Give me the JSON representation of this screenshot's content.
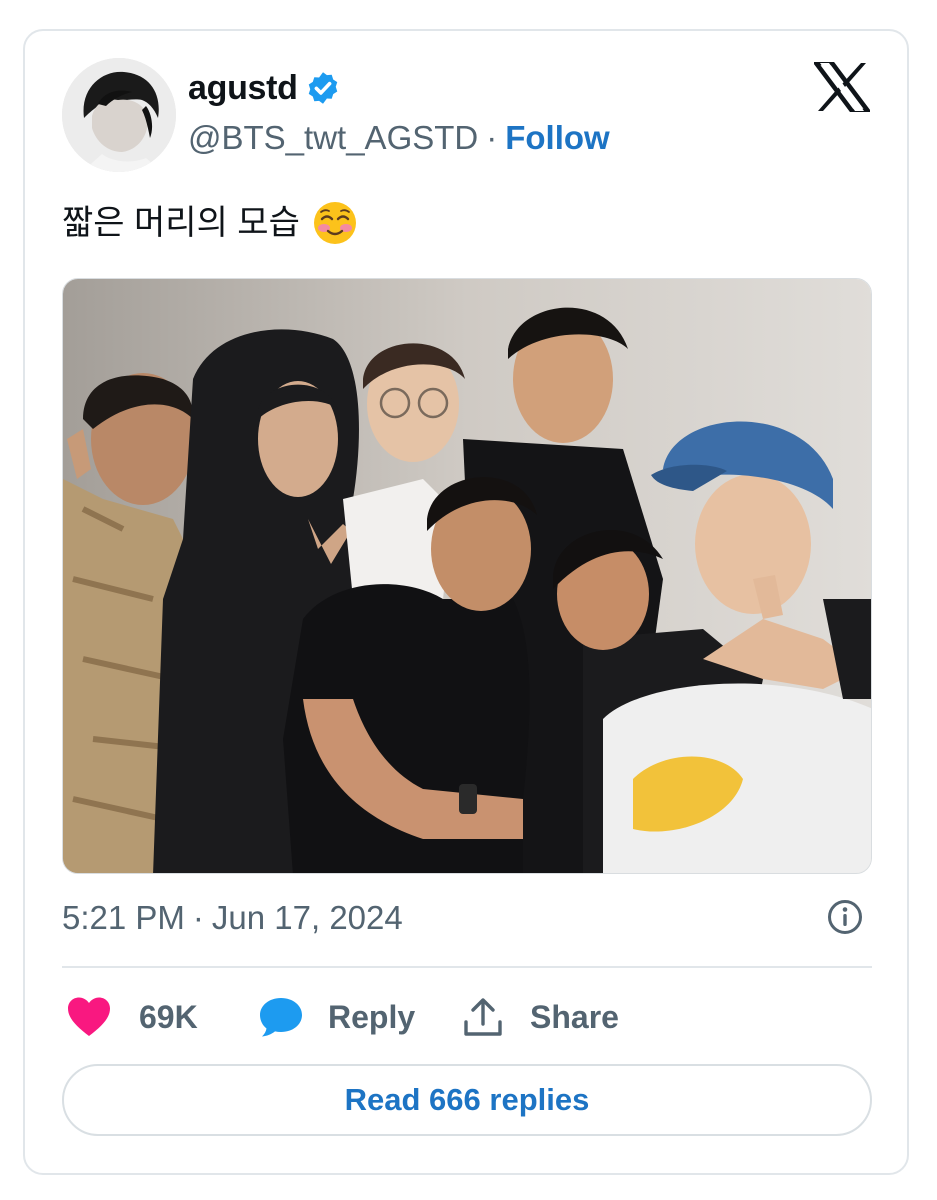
{
  "user": {
    "display_name": "agustd",
    "handle": "@BTS_twt_AGSTD",
    "separator": "·",
    "follow_label": "Follow",
    "verified": true,
    "avatar_icon": "profile-photo"
  },
  "brand": {
    "logo_icon": "x-logo-icon"
  },
  "tweet": {
    "text": "짧은 머리의 모습",
    "emoji_icon": "smiling-face-with-blush-icon",
    "media_description_icon": "group-photo"
  },
  "meta": {
    "time": "5:21 PM",
    "separator": "·",
    "date": "Jun 17, 2024",
    "info_icon": "info-icon"
  },
  "actions": {
    "like_count": "69K",
    "reply_label": "Reply",
    "share_label": "Share"
  },
  "read_replies_label": "Read 666 replies",
  "colors": {
    "link_blue": "#1d74c4",
    "verified_blue": "#1d9bf0",
    "like_pink": "#f91880",
    "reply_blue": "#1d9bf0",
    "secondary_text": "#536471",
    "primary_text": "#0f1419",
    "border": "#e1e6ea"
  }
}
